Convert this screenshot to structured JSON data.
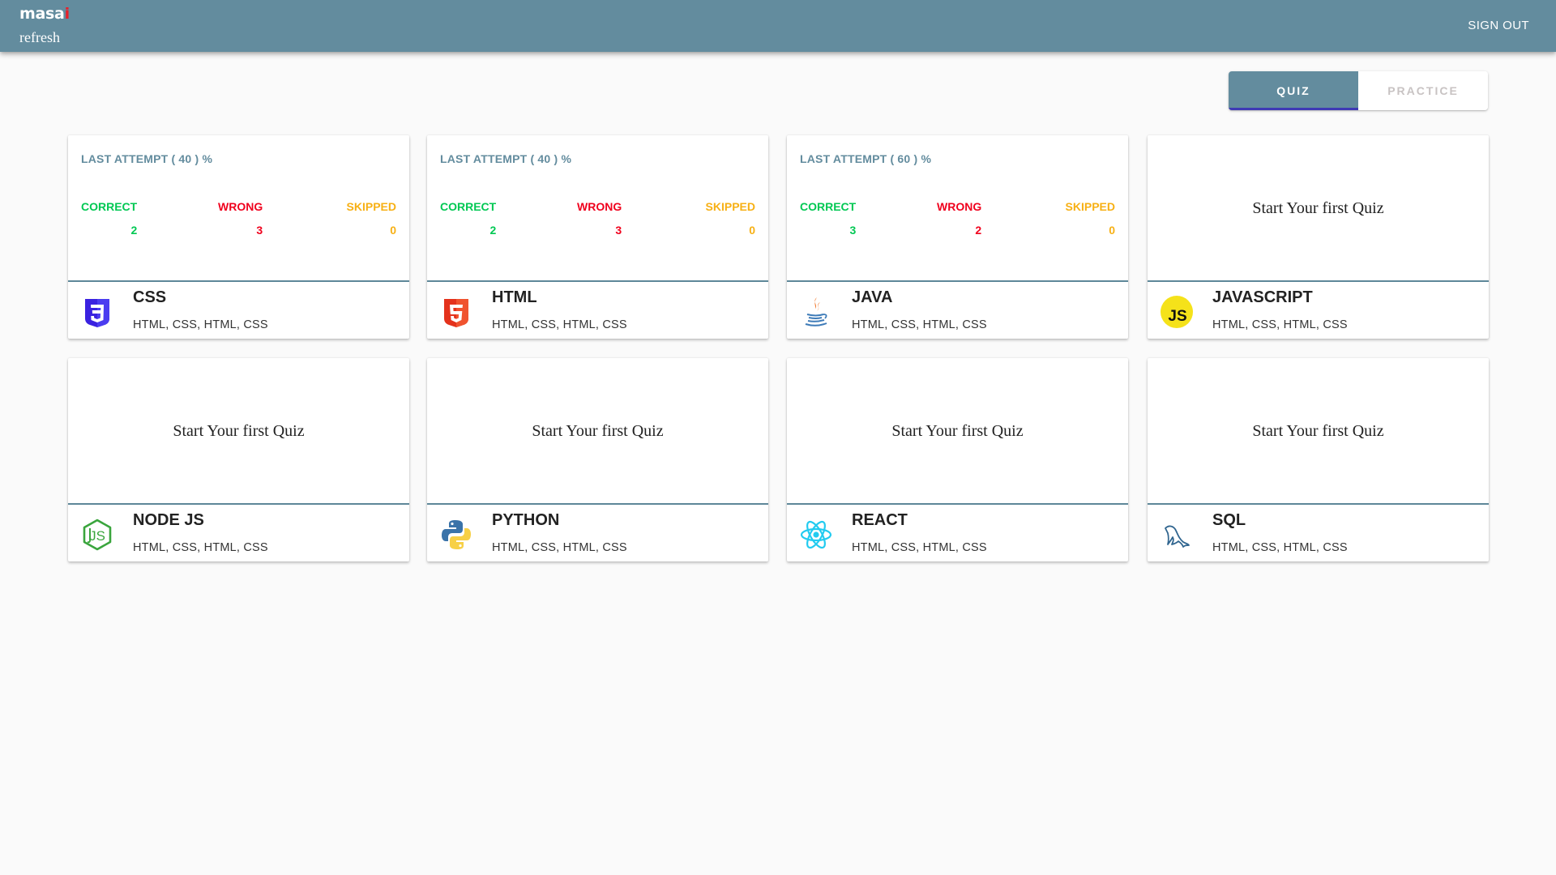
{
  "header": {
    "logo_text": "masa",
    "logo_accent": "i",
    "refresh_label": "refresh",
    "signout_label": "SIGN OUT"
  },
  "tabs": [
    {
      "label": "QUIZ",
      "active": true
    },
    {
      "label": "PRACTICE",
      "active": false
    }
  ],
  "colors": {
    "brand": "#638c9e",
    "tab_indicator": "#3f3ab5",
    "correct": "#00c853",
    "wrong": "#f0001d",
    "skipped": "#f7b014"
  },
  "labels": {
    "correct": "CORRECT",
    "wrong": "WRONG",
    "skipped": "SKIPPED",
    "start_quiz": "Start Your first Quiz"
  },
  "cards": [
    {
      "title": "CSS",
      "tags": "HTML, CSS, HTML, CSS",
      "icon": "css3-icon",
      "attempt": "LAST ATTEMPT ( 40 ) %",
      "correct": "2",
      "wrong": "3",
      "skipped": "0"
    },
    {
      "title": "HTML",
      "tags": "HTML, CSS, HTML, CSS",
      "icon": "html5-icon",
      "attempt": "LAST ATTEMPT ( 40 ) %",
      "correct": "2",
      "wrong": "3",
      "skipped": "0"
    },
    {
      "title": "JAVA",
      "tags": "HTML, CSS, HTML, CSS",
      "icon": "java-icon",
      "attempt": "LAST ATTEMPT ( 60 ) %",
      "correct": "3",
      "wrong": "2",
      "skipped": "0"
    },
    {
      "title": "JAVASCRIPT",
      "tags": "HTML, CSS, HTML, CSS",
      "icon": "javascript-icon",
      "start": "Start Your first Quiz"
    },
    {
      "title": "NODE JS",
      "tags": "HTML, CSS, HTML, CSS",
      "icon": "nodejs-icon",
      "start": "Start Your first Quiz"
    },
    {
      "title": "PYTHON",
      "tags": "HTML, CSS, HTML, CSS",
      "icon": "python-icon",
      "start": "Start Your first Quiz"
    },
    {
      "title": "REACT",
      "tags": "HTML, CSS, HTML, CSS",
      "icon": "react-icon",
      "start": "Start Your first Quiz"
    },
    {
      "title": "SQL",
      "tags": "HTML, CSS, HTML, CSS",
      "icon": "mysql-icon",
      "start": "Start Your first Quiz"
    }
  ]
}
